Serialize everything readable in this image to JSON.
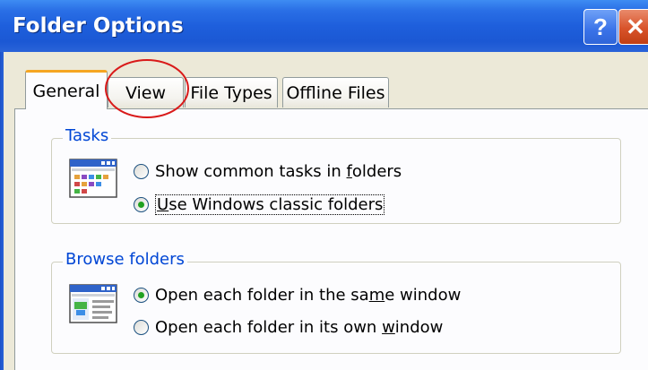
{
  "window": {
    "title": "Folder Options",
    "help_glyph": "?",
    "close_glyph": "✕"
  },
  "tabs": [
    {
      "label": "General",
      "active": true
    },
    {
      "label": "View",
      "active": false
    },
    {
      "label": "File Types",
      "active": false
    },
    {
      "label": "Offline Files",
      "active": false
    }
  ],
  "tasks_group": {
    "title": "Tasks",
    "options": [
      {
        "pre": "Show common tasks in ",
        "ul": "f",
        "post": "olders",
        "checked": false
      },
      {
        "pre": "",
        "ul": "U",
        "post": "se Windows classic folders",
        "checked": true
      }
    ]
  },
  "browse_group": {
    "title": "Browse folders",
    "options": [
      {
        "pre": "Open each folder in the sa",
        "ul": "m",
        "post": "e window",
        "checked": true
      },
      {
        "pre": "Open each folder in its own ",
        "ul": "w",
        "post": "indow",
        "checked": false
      }
    ]
  },
  "colors": {
    "titlebar": "#1e5fdc",
    "active_tab_accent": "#f5a623",
    "group_title": "#0046d5",
    "annotation": "#d91a1a"
  }
}
